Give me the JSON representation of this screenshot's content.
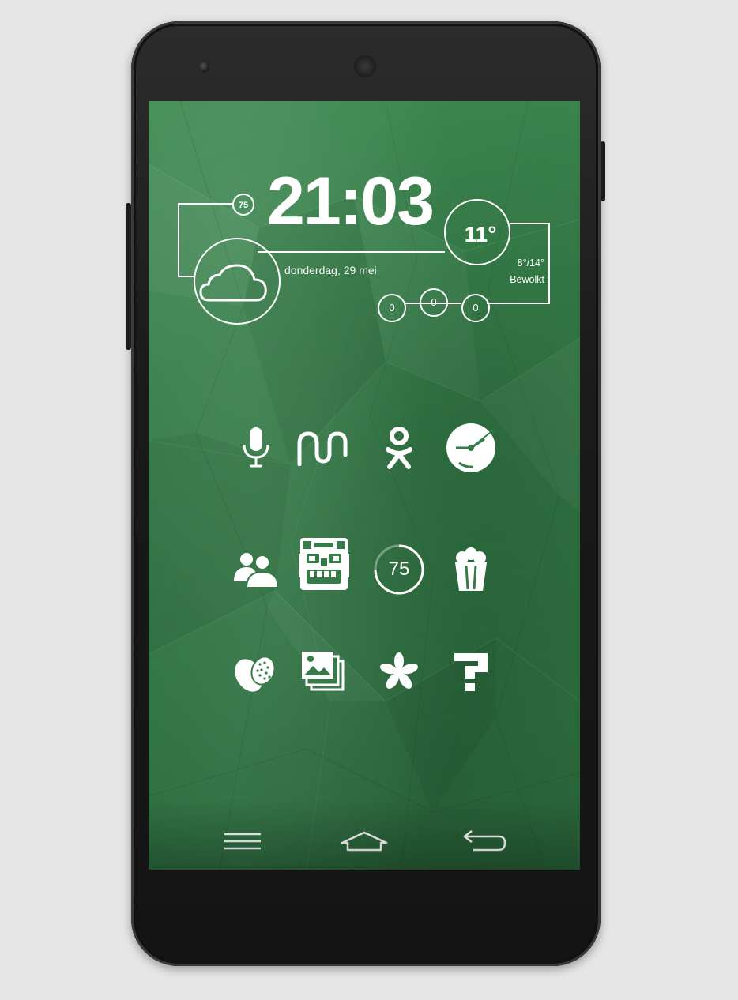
{
  "widget": {
    "time": "21:03",
    "date": "donderdag, 29 mei",
    "temperature": "11°",
    "temp_range": "8°/14°",
    "condition": "Bewolkt",
    "battery_badge": "75",
    "counters": [
      "0",
      "0",
      "0"
    ]
  },
  "home_icons": [
    {
      "name": "voice-search-icon"
    },
    {
      "name": "mu-app-icon"
    },
    {
      "name": "odnoklassniki-icon"
    },
    {
      "name": "clock-app-icon"
    },
    {
      "name": "contacts-icon"
    },
    {
      "name": "temple-run-icon"
    },
    {
      "name": "battery-widget-icon",
      "label": "75"
    },
    {
      "name": "popcorn-icon"
    },
    {
      "name": "jelly-bean-icon"
    },
    {
      "name": "gallery-icon"
    },
    {
      "name": "asterisk-icon"
    },
    {
      "name": "question-mark-icon"
    }
  ],
  "navbar": {
    "menu": "menu-icon",
    "home": "home-icon",
    "back": "back-icon"
  },
  "colors": {
    "wallpaper": "#357c48",
    "foreground": "#ffffff",
    "phone_body": "#1a1a1a",
    "background": "#e6e6e6"
  }
}
